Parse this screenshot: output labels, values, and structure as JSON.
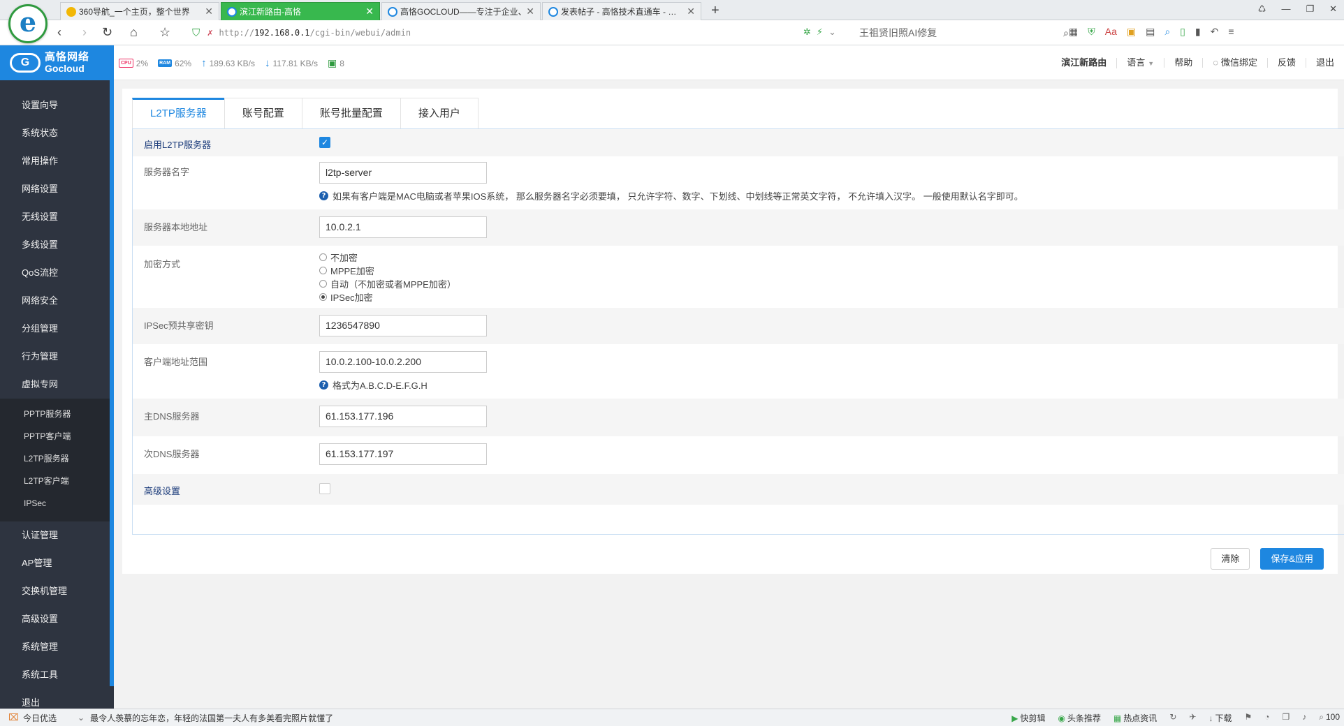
{
  "browser": {
    "logo_letter": "e",
    "tabs": [
      {
        "title": "360导航_一个主页，整个世界",
        "active": false
      },
      {
        "title": "滨江新路由-高恪",
        "active": true
      },
      {
        "title": "高恪GOCLOUD——专注于企业、网",
        "active": false
      },
      {
        "title": "发表帖子 - 高恪技术直通车 - …",
        "active": false
      }
    ],
    "new_tab": "+",
    "url_scheme": "http://",
    "url_host": "192.168.0.1",
    "url_path": "/cgi-bin/webui/admin",
    "search_hint": "王祖贤旧照AI修复"
  },
  "app": {
    "brand_line1": "高恪网络",
    "brand_line2": "Gocloud",
    "stats": {
      "cpu_chip": "CPU",
      "cpu": "2%",
      "ram_chip": "RAM",
      "ram": "62%",
      "upload": "189.63 KB/s",
      "download": "117.81 KB/s",
      "online": "8"
    },
    "header_menu": {
      "device_name": "滨江新路由",
      "language": "语言",
      "help": "帮助",
      "wechat": "微信绑定",
      "feedback": "反馈",
      "logout": "退出"
    }
  },
  "sidebar": {
    "items_top": [
      "设置向导",
      "系统状态",
      "常用操作",
      "网络设置",
      "无线设置",
      "多线设置",
      "QoS流控",
      "网络安全",
      "分组管理",
      "行为管理",
      "虚拟专网"
    ],
    "sub_items": [
      "PPTP服务器",
      "PPTP客户端",
      "L2TP服务器",
      "L2TP客户端",
      "IPSec"
    ],
    "items_bottom": [
      "认证管理",
      "AP管理",
      "交换机管理",
      "高级设置",
      "系统管理",
      "系统工具",
      "退出"
    ]
  },
  "content": {
    "tabs": [
      "L2TP服务器",
      "账号配置",
      "账号批量配置",
      "接入用户"
    ],
    "form": {
      "enable_label": "启用L2TP服务器",
      "enable_checked": true,
      "server_name_label": "服务器名字",
      "server_name_value": "l2tp-server",
      "server_name_help": "如果有客户端是MAC电脑或者苹果IOS系统， 那么服务器名字必须要填， 只允许字符、数字、下划线、中划线等正常英文字符， 不允许填入汉字。 一般使用默认名字即可。",
      "local_addr_label": "服务器本地地址",
      "local_addr_value": "10.0.2.1",
      "encryption_label": "加密方式",
      "encryption_options": [
        "不加密",
        "MPPE加密",
        "自动（不加密或者MPPE加密）",
        "IPSec加密"
      ],
      "encryption_selected": "IPSec加密",
      "psk_label": "IPSec预共享密钥",
      "psk_value": "1236547890",
      "client_range_label": "客户端地址范围",
      "client_range_value": "10.0.2.100-10.0.2.200",
      "client_range_help": "格式为A.B.C.D-E.F.G.H",
      "dns1_label": "主DNS服务器",
      "dns1_value": "61.153.177.196",
      "dns2_label": "次DNS服务器",
      "dns2_value": "61.153.177.197",
      "advanced_label": "高级设置",
      "advanced_checked": false
    },
    "actions": {
      "clear": "清除",
      "save": "保存&应用"
    }
  },
  "statusbar": {
    "today": "今日优选",
    "news": "最令人羡慕的忘年恋，年轻的法国第一夫人有多美看完照片就懂了",
    "items": [
      "快剪辑",
      "头条推荐",
      "热点资讯",
      "下载",
      "100"
    ]
  }
}
